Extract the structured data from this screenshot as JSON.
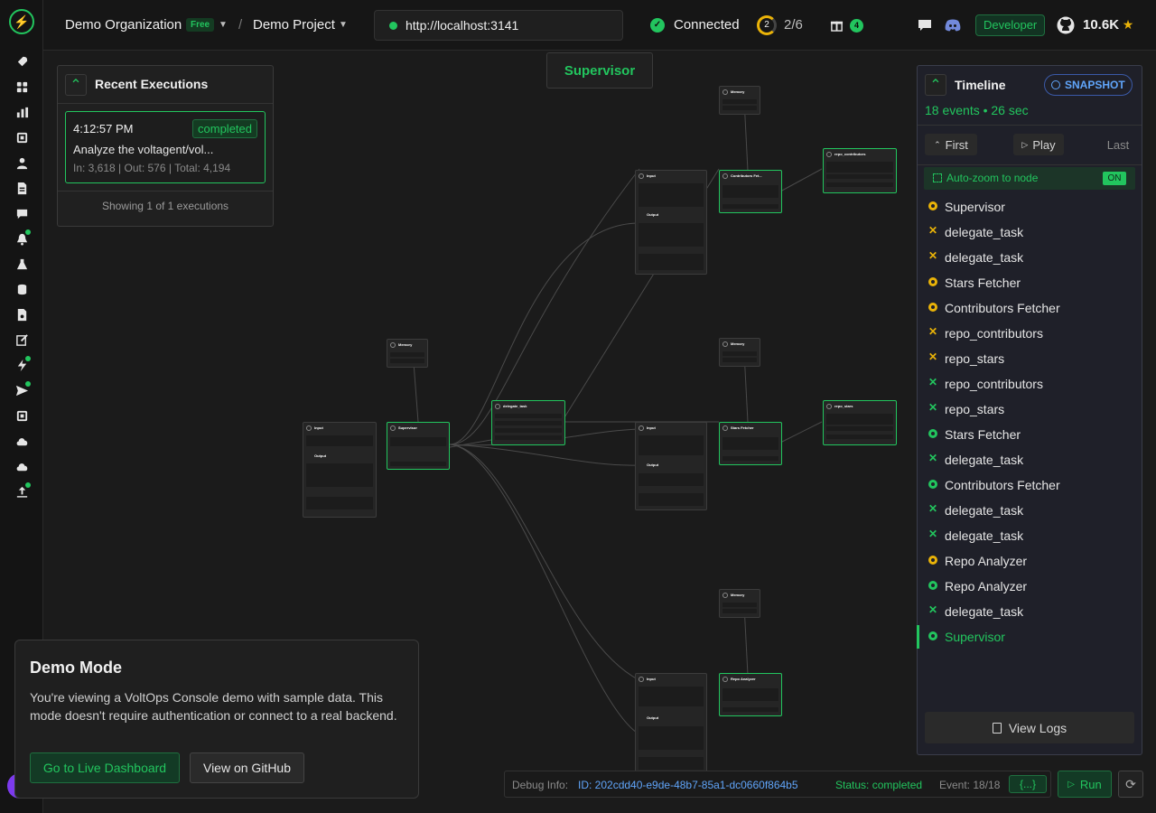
{
  "header": {
    "org_name": "Demo Organization",
    "org_plan": "Free",
    "separator": "/",
    "project_name": "Demo Project",
    "url": "http://localhost:3141",
    "connection_status": "Connected",
    "progress_number": "2",
    "progress_text": "2/6",
    "gift_count": "4",
    "role_badge": "Developer",
    "github_stars": "10.6K"
  },
  "sidebar": {
    "icons": [
      "rocket-icon",
      "grid-icon",
      "bar-chart-icon",
      "chip-icon",
      "user-icon",
      "document-icon",
      "chat-icon",
      "bell-icon",
      "flask-icon",
      "database-icon",
      "file-lock-icon",
      "edit-icon",
      "bolt-icon",
      "send-icon",
      "cpu-icon",
      "cloud-icon",
      "cloud-alt-icon",
      "upload-icon"
    ]
  },
  "recent_executions": {
    "title": "Recent Executions",
    "time": "4:12:57 PM",
    "status": "completed",
    "task": "Analyze the voltagent/vol...",
    "tokens": "In: 3,618 | Out: 576 | Total: 4,194",
    "footer": "Showing 1 of 1 executions"
  },
  "canvas": {
    "supervisor_label": "Supervisor",
    "nodes": {
      "memory": "Memory",
      "input": "Input",
      "output": "Output",
      "supervisor": "Supervisor",
      "delegate_task": "delegate_task",
      "contributors_fetcher": "Contributors Fet...",
      "repo_contributors": "repo_contributors",
      "stars_fetcher": "Stars Fetcher",
      "repo_stars": "repo_stars",
      "repo_analyzer": "Repo Analyzer"
    }
  },
  "timeline": {
    "title": "Timeline",
    "snapshot_label": "SNAPSHOT",
    "summary": "18 events • 26 sec",
    "first_label": "First",
    "play_label": "Play",
    "last_label": "Last",
    "autozoom_label": "Auto-zoom to node",
    "autozoom_state": "ON",
    "events": [
      {
        "label": "Supervisor",
        "kind": "agent",
        "color": "#eab308"
      },
      {
        "label": "delegate_task",
        "kind": "tool",
        "color": "#eab308"
      },
      {
        "label": "delegate_task",
        "kind": "tool",
        "color": "#eab308"
      },
      {
        "label": "Stars Fetcher",
        "kind": "agent",
        "color": "#eab308"
      },
      {
        "label": "Contributors Fetcher",
        "kind": "agent",
        "color": "#eab308"
      },
      {
        "label": "repo_contributors",
        "kind": "tool",
        "color": "#eab308"
      },
      {
        "label": "repo_stars",
        "kind": "tool",
        "color": "#eab308"
      },
      {
        "label": "repo_contributors",
        "kind": "tool",
        "color": "#22c55e"
      },
      {
        "label": "repo_stars",
        "kind": "tool",
        "color": "#22c55e"
      },
      {
        "label": "Stars Fetcher",
        "kind": "agent",
        "color": "#22c55e"
      },
      {
        "label": "delegate_task",
        "kind": "tool",
        "color": "#22c55e"
      },
      {
        "label": "Contributors Fetcher",
        "kind": "agent",
        "color": "#22c55e"
      },
      {
        "label": "delegate_task",
        "kind": "tool",
        "color": "#22c55e"
      },
      {
        "label": "delegate_task",
        "kind": "tool",
        "color": "#22c55e"
      },
      {
        "label": "Repo Analyzer",
        "kind": "agent",
        "color": "#eab308"
      },
      {
        "label": "Repo Analyzer",
        "kind": "agent",
        "color": "#22c55e"
      },
      {
        "label": "delegate_task",
        "kind": "tool",
        "color": "#22c55e"
      },
      {
        "label": "Supervisor",
        "kind": "agent",
        "color": "#22c55e"
      }
    ],
    "view_logs_label": "View Logs"
  },
  "demo_mode": {
    "title": "Demo Mode",
    "description": "You're viewing a VoltOps Console demo with sample data. This mode doesn't require authentication or connect to a real backend.",
    "live_button": "Go to Live Dashboard",
    "github_button": "View on GitHub"
  },
  "debug": {
    "label": "Debug Info:",
    "id": "ID: 202cdd40-e9de-48b7-85a1-dc0660f864b5",
    "status": "Status: completed",
    "event": "Event: 18/18",
    "json_label": "{...}",
    "run_label": "Run"
  },
  "colors": {
    "accent": "#22c55e",
    "pending": "#eab308",
    "link": "#60a5fa"
  }
}
